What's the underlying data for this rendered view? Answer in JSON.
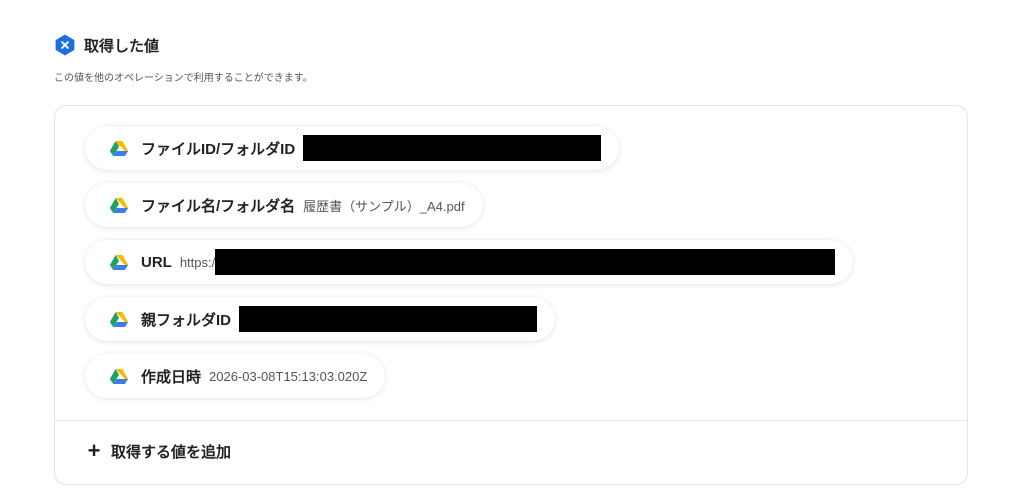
{
  "section": {
    "title": "取得した値",
    "description": "この値を他のオペレーションで利用することができます。"
  },
  "fields": [
    {
      "label": "ファイルID/フォルダID",
      "value": "",
      "redacted": true
    },
    {
      "label": "ファイル名/フォルダ名",
      "value": "履歴書（サンプル）_A4.pdf",
      "redacted": false
    },
    {
      "label": "URL",
      "value": "https:/",
      "redacted": true
    },
    {
      "label": "親フォルダID",
      "value": "",
      "redacted": true
    },
    {
      "label": "作成日時",
      "value": "2026-03-08T15:13:03.020Z",
      "redacted": false
    }
  ],
  "add_button": {
    "label": "取得する値を追加"
  },
  "icons": {
    "section": "hexagon-x-icon",
    "field": "google-drive-icon",
    "add": "plus-icon"
  },
  "colors": {
    "accent": "#1e6fe0",
    "drive_green": "#1ea362",
    "drive_yellow": "#f9b900",
    "drive_blue": "#3a7ded",
    "redaction": "#000000"
  }
}
